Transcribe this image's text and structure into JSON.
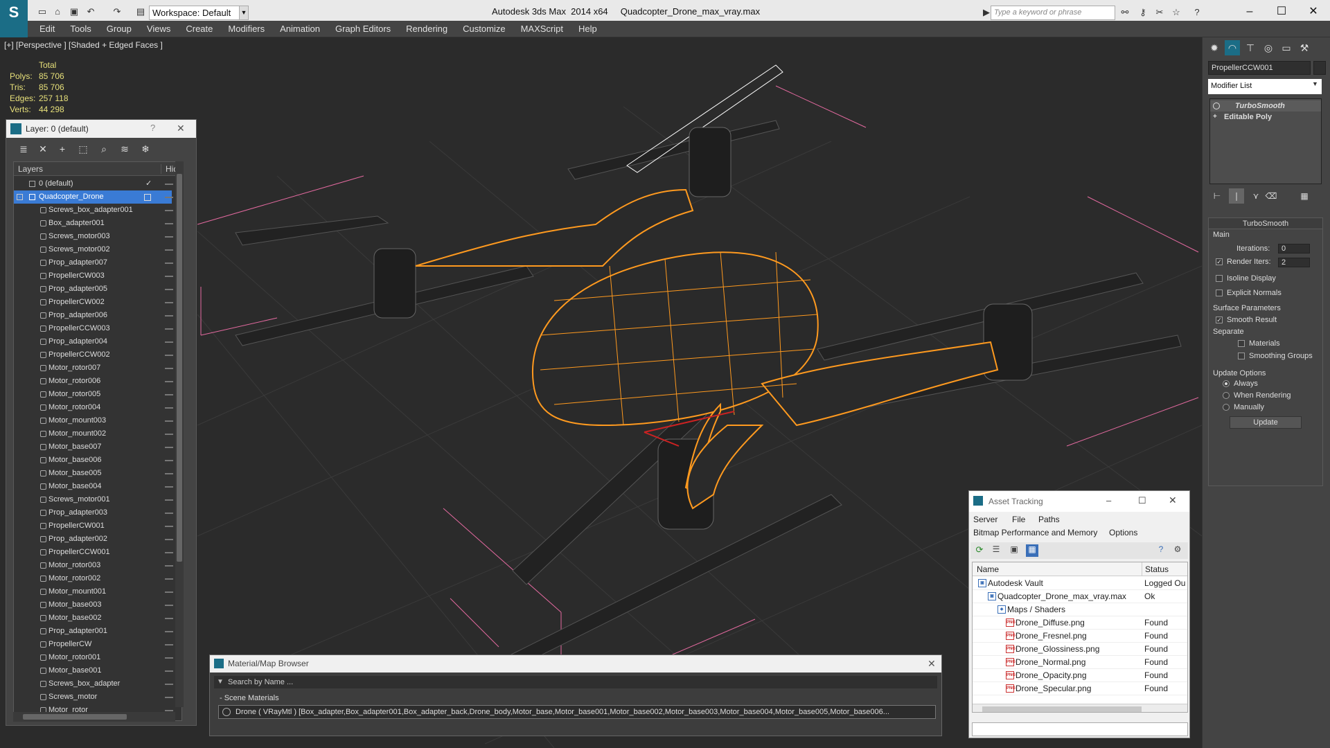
{
  "titlebar": {
    "workspace": "Workspace: Default",
    "app_title": "Autodesk 3ds Max  2014 x64     Quadcopter_Drone_max_vray.max",
    "search_placeholder": "Type a keyword or phrase"
  },
  "menu": [
    "Edit",
    "Tools",
    "Group",
    "Views",
    "Create",
    "Modifiers",
    "Animation",
    "Graph Editors",
    "Rendering",
    "Customize",
    "MAXScript",
    "Help"
  ],
  "viewport": {
    "label": "[+] [Perspective ] [Shaded + Edged Faces ]",
    "stats": {
      "header": "Total",
      "polys_label": "Polys:",
      "polys": "85 706",
      "tris_label": "Tris:",
      "tris": "85 706",
      "edges_label": "Edges:",
      "edges": "257 118",
      "verts_label": "Verts:",
      "verts": "44 298"
    }
  },
  "layer_panel": {
    "title": "Layer: 0 (default)",
    "help": "?",
    "close": "✕",
    "col_layers": "Layers",
    "col_hide": "Hide",
    "default_layer": "0 (default)",
    "selected_layer": "Quadcopter_Drone",
    "objects": [
      "Screws_box_adapter001",
      "Box_adapter001",
      "Screws_motor003",
      "Screws_motor002",
      "Prop_adapter007",
      "PropellerCW003",
      "Prop_adapter005",
      "PropellerCW002",
      "Prop_adapter006",
      "PropellerCCW003",
      "Prop_adapter004",
      "PropellerCCW002",
      "Motor_rotor007",
      "Motor_rotor006",
      "Motor_rotor005",
      "Motor_rotor004",
      "Motor_mount003",
      "Motor_mount002",
      "Motor_base007",
      "Motor_base006",
      "Motor_base005",
      "Motor_base004",
      "Screws_motor001",
      "Prop_adapter003",
      "PropellerCW001",
      "Prop_adapter002",
      "PropellerCCW001",
      "Motor_rotor003",
      "Motor_rotor002",
      "Motor_mount001",
      "Motor_base003",
      "Motor_base002",
      "Prop_adapter001",
      "PropellerCW",
      "Motor_rotor001",
      "Motor_base001",
      "Screws_box_adapter",
      "Screws_motor",
      "Motor_rotor"
    ]
  },
  "command_panel": {
    "object_name": "PropellerCCW001",
    "modifier_list": "Modifier List",
    "stack": [
      "TurboSmooth",
      "Editable Poly"
    ],
    "turbosmooth": {
      "title": "TurboSmooth",
      "main": "Main",
      "iterations_label": "Iterations:",
      "iterations": "0",
      "render_iters_label": "Render Iters:",
      "render_iters": "2",
      "isoline": "Isoline Display",
      "explicit_normals": "Explicit Normals",
      "surface_params": "Surface Parameters",
      "smooth_result": "Smooth Result",
      "separate": "Separate",
      "materials": "Materials",
      "smoothing_groups": "Smoothing Groups",
      "update_options": "Update Options",
      "always": "Always",
      "when_rendering": "When Rendering",
      "manually": "Manually",
      "update_button": "Update"
    }
  },
  "material_browser": {
    "title": "Material/Map Browser",
    "search": "Search by Name ...",
    "section": "- Scene Materials",
    "item": "Drone ( VRayMtl ) [Box_adapter,Box_adapter001,Box_adapter_back,Drone_body,Motor_base,Motor_base001,Motor_base002,Motor_base003,Motor_base004,Motor_base005,Motor_base006..."
  },
  "asset_tracking": {
    "title": "Asset Tracking",
    "menu": [
      "Server",
      "File",
      "Paths",
      "Bitmap Performance and Memory",
      "Options"
    ],
    "col_name": "Name",
    "col_status": "Status",
    "rows": [
      {
        "name": "Autodesk Vault",
        "status": "Logged Ou"
      },
      {
        "name": "Quadcopter_Drone_max_vray.max",
        "status": "Ok"
      },
      {
        "name": "Maps / Shaders",
        "status": ""
      },
      {
        "name": "Drone_Diffuse.png",
        "status": "Found"
      },
      {
        "name": "Drone_Fresnel.png",
        "status": "Found"
      },
      {
        "name": "Drone_Glossiness.png",
        "status": "Found"
      },
      {
        "name": "Drone_Normal.png",
        "status": "Found"
      },
      {
        "name": "Drone_Opacity.png",
        "status": "Found"
      },
      {
        "name": "Drone_Specular.png",
        "status": "Found"
      }
    ]
  },
  "colors": {
    "accent": "#1b6d86",
    "wire": "#ff9a1f",
    "selection": "#3a7bd5",
    "stats": "#e7e07a"
  }
}
